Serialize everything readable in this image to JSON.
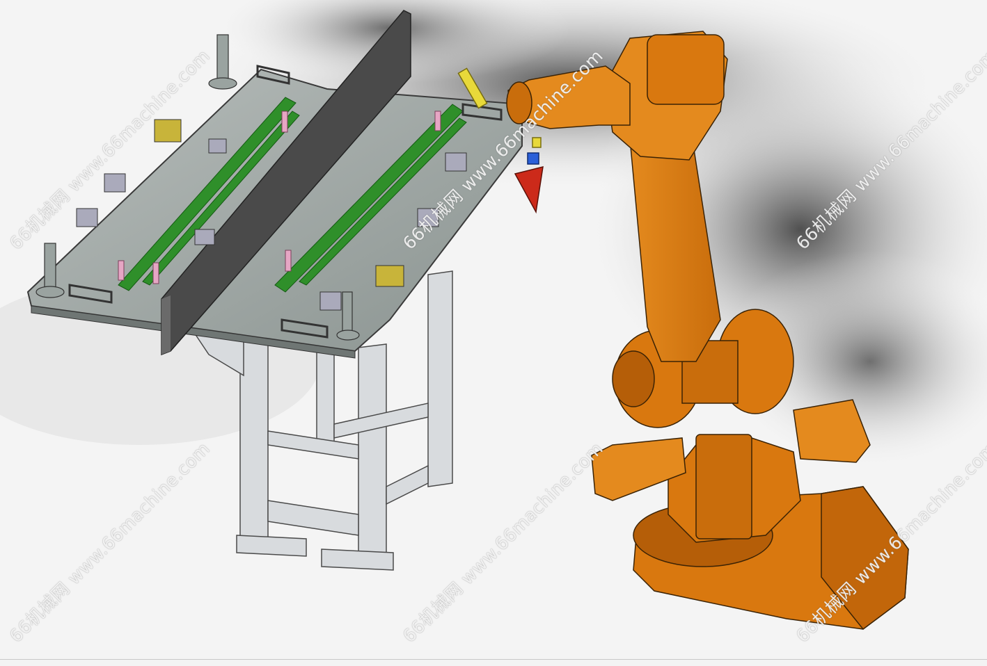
{
  "scene": {
    "description_colors": {
      "robot": "#d9780f",
      "robot_shade": "#b55e08",
      "fixture_plate": "#9aa3a0",
      "frame": "#d8dbde",
      "rail": "#2f8f2a",
      "panel": "#4a4a4a",
      "clamp_yellow": "#c8b43a"
    }
  },
  "watermarks": {
    "text": "66机械网 www.66machine.com"
  }
}
